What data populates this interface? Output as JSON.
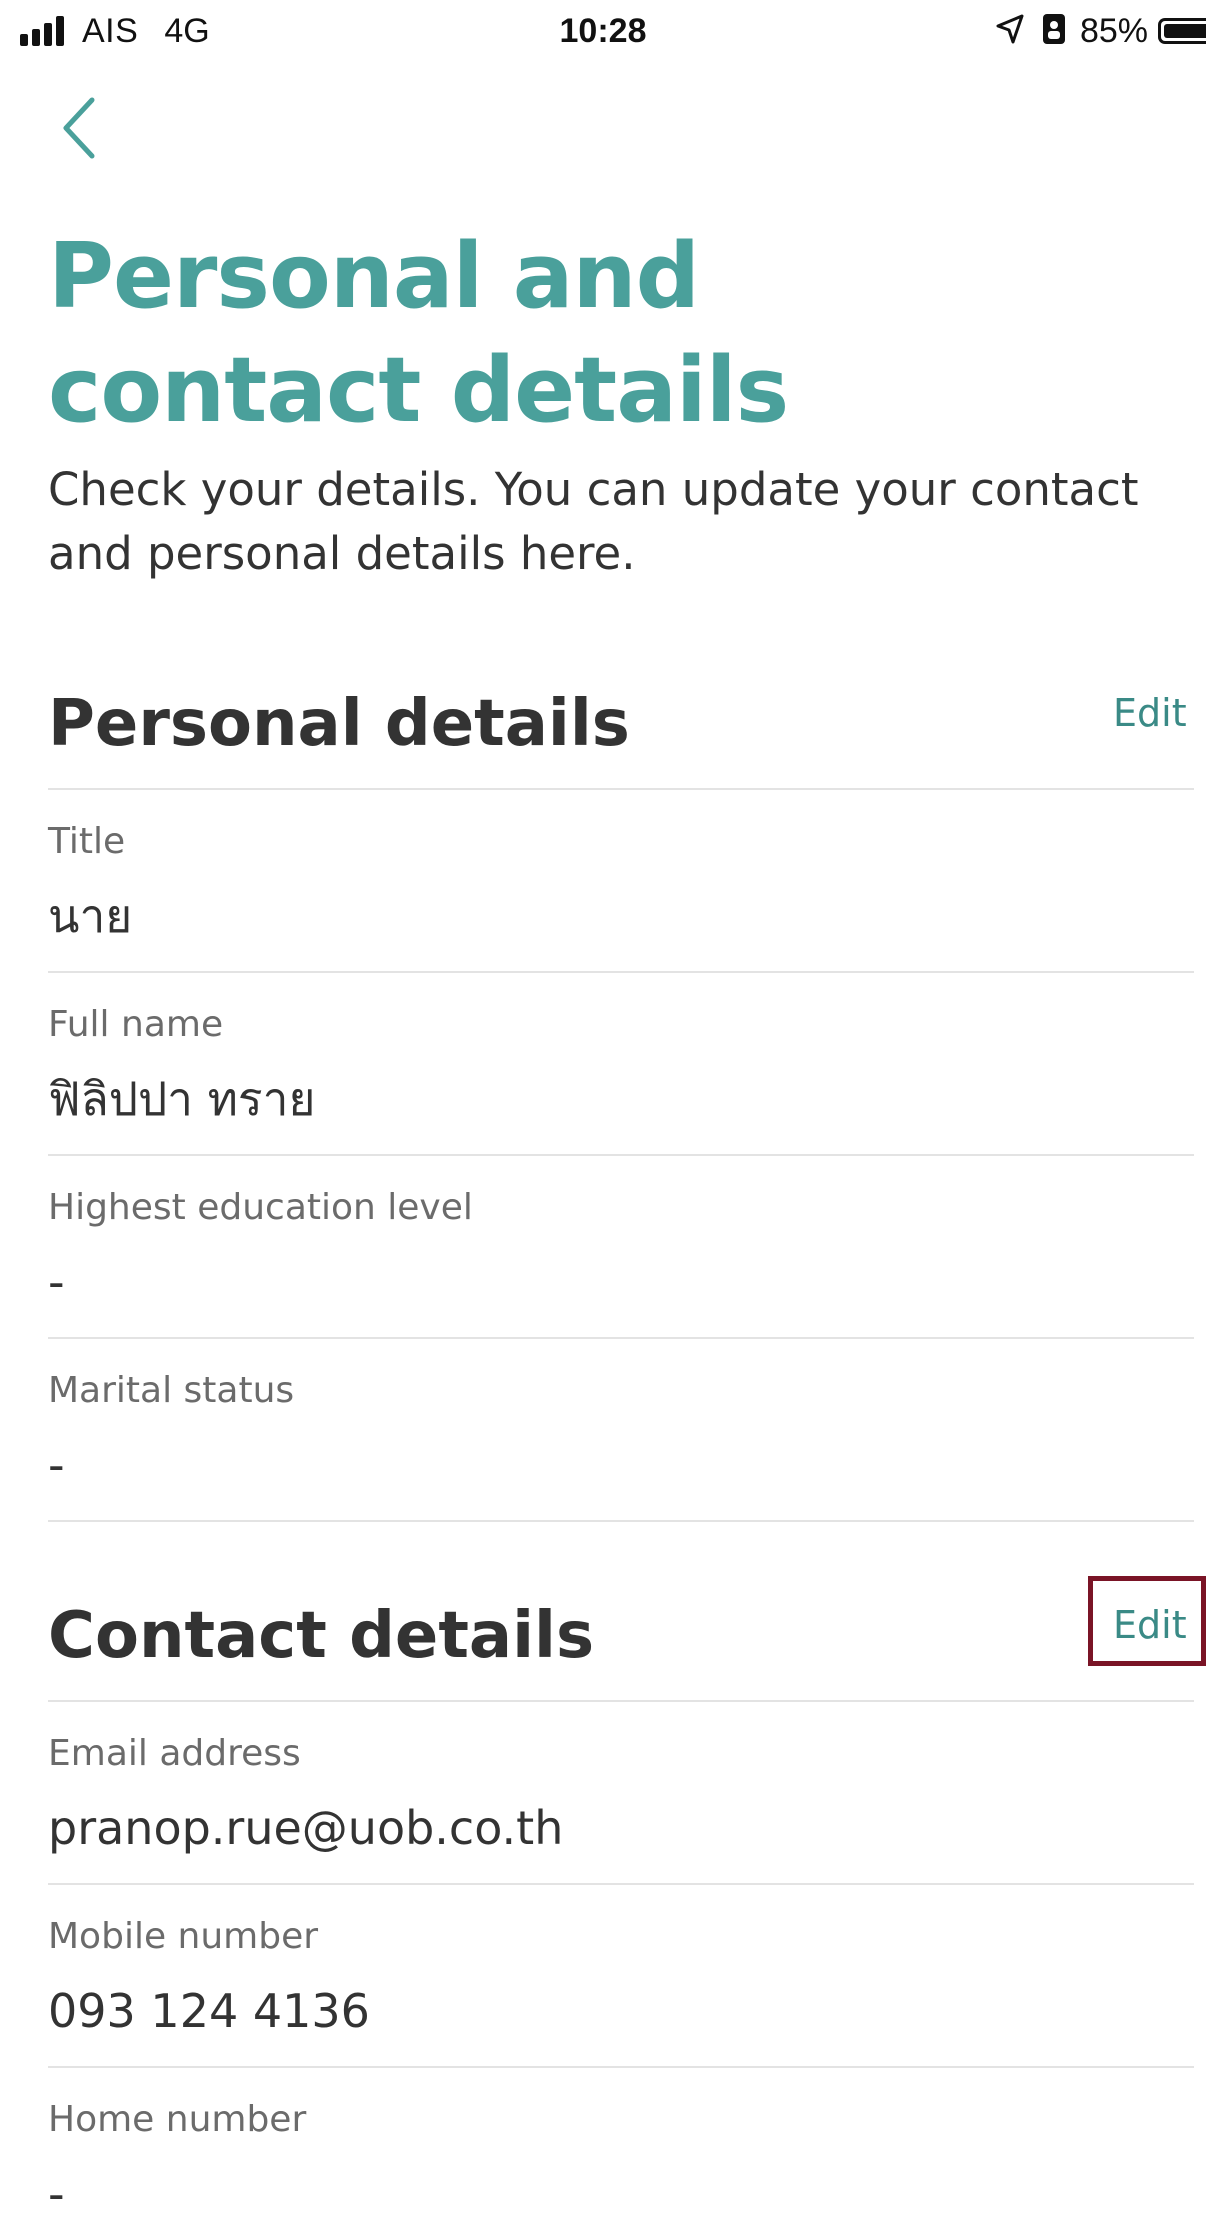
{
  "status_bar": {
    "carrier": "AIS",
    "network": "4G",
    "time": "10:28",
    "battery_percent": "85%",
    "icons": [
      "signal-bars-icon",
      "location-arrow-icon",
      "portrait-lock-icon",
      "battery-icon"
    ]
  },
  "header": {
    "back_icon": "chevron-left-icon",
    "title_line1": "Personal and",
    "title_line2": "contact details",
    "subtitle_line1": "Check your details. You can update your contact",
    "subtitle_line2": "and personal details here."
  },
  "personal": {
    "heading": "Personal details",
    "edit_label": "Edit",
    "fields": [
      {
        "label": "Title",
        "value": "นาย"
      },
      {
        "label": "Full name",
        "value": "ฟิลิปปา ทราย"
      },
      {
        "label": "Highest education level",
        "value": "-"
      },
      {
        "label": "Marital status",
        "value": "-"
      }
    ]
  },
  "contact": {
    "heading": "Contact details",
    "edit_label": "Edit",
    "fields": [
      {
        "label": "Email address",
        "value": "pranop.rue@uob.co.th"
      },
      {
        "label": "Mobile number",
        "value": "093 124 4136"
      },
      {
        "label": "Home number",
        "value": "-"
      }
    ]
  },
  "colors": {
    "accent": "#4aa09b",
    "link": "#3a8a86",
    "highlight_border": "#7a1426",
    "text": "#333333",
    "label": "#6b6b6b",
    "divider": "#e3e3e3"
  }
}
